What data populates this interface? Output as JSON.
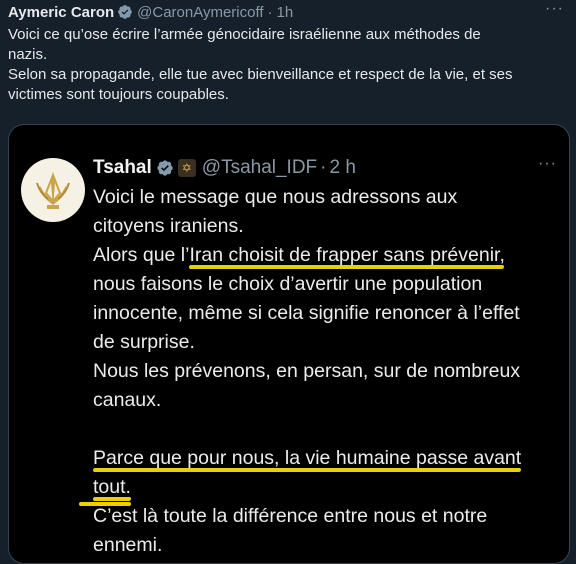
{
  "tweet": {
    "author_name": "Aymeric Caron",
    "handle": "@CaronAymericoff",
    "separator": "·",
    "time": "1h",
    "more_label": "···",
    "text_lines": [
      "Voici ce qu’ose écrire l’armée génocidaire israélienne aux méthodes de",
      "nazis.",
      "Selon sa propagande, elle tue avec bienveillance et respect de la vie, et ses",
      "victimes sont toujours coupables."
    ]
  },
  "quoted": {
    "author_name": "Tsahal",
    "handle": "@Tsahal_IDF",
    "separator": "·",
    "time": "2 h",
    "more_label": "···",
    "lines": [
      "Voici le message que nous adressons aux",
      "citoyens iraniens.",
      "Alors que l’Iran choisit de frapper sans prévenir,",
      "nous faisons le choix d’avertir une population",
      "innocente, même si cela signifie renoncer à l’effet",
      "de surprise.",
      "Nous les prévenons, en persan, sur de nombreux",
      "canaux.",
      "",
      "Parce que pour nous, la vie humaine passe avant",
      "tout.",
      "C’est là toute la différence entre nous et notre",
      "ennemi."
    ],
    "highlighted_phrases": [
      "Iran choisit de frapper sans prévenir,",
      "Parce que pour nous, la vie humaine passe avant",
      "tout."
    ]
  },
  "colors": {
    "background": "#15202b",
    "quote_background": "#000000",
    "verified": "#829aab",
    "highlight": "#e8d10a",
    "muted": "#8b98a5"
  },
  "icons": {
    "verified_badge": "verified-badge-icon",
    "avatar": "idf-emblem-icon",
    "flag": "org-flag-icon"
  }
}
